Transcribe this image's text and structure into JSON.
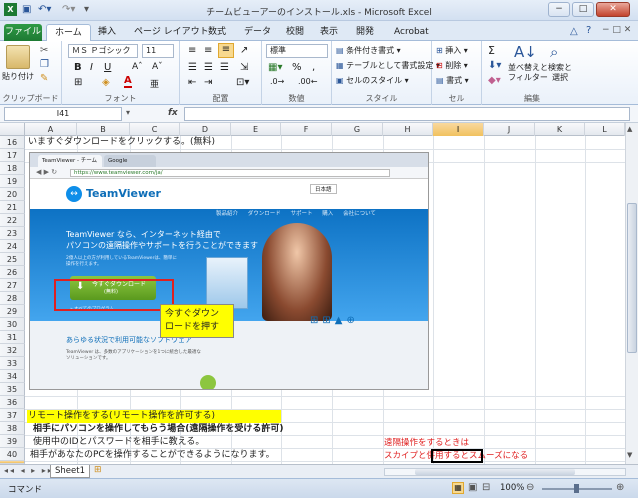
{
  "window": {
    "title": "チームビューアーのインストール.xls - Microsoft Excel",
    "minimize": "−",
    "restore": "□",
    "close": "✕"
  },
  "tabs": [
    {
      "label": "ファイル"
    },
    {
      "label": "ホーム"
    },
    {
      "label": "挿入"
    },
    {
      "label": "ページ レイアウト"
    },
    {
      "label": "数式"
    },
    {
      "label": "データ"
    },
    {
      "label": "校閲"
    },
    {
      "label": "表示"
    },
    {
      "label": "開発"
    },
    {
      "label": "Acrobat"
    }
  ],
  "ribbon": {
    "clipboard": {
      "paste": "貼り付け",
      "label": "クリップボード"
    },
    "font": {
      "name": "ＭＳ Ｐゴシック",
      "size": "11",
      "label": "フォント",
      "bold": "B",
      "italic": "I",
      "underline": "U"
    },
    "alignment": {
      "label": "配置"
    },
    "number": {
      "format": "標準",
      "label": "数値",
      "percent": "%",
      "comma": ","
    },
    "styles": {
      "conditional": "条件付き書式",
      "table": "テーブルとして書式設定",
      "cell": "セルのスタイル",
      "label": "スタイル"
    },
    "cells": {
      "insert": "挿入",
      "delete": "削除",
      "format": "書式",
      "label": "セル"
    },
    "editing": {
      "sum": "Σ",
      "sort": "並べ替えと\nフィルター",
      "find": "検索と\n選択",
      "label": "編集"
    }
  },
  "formula_bar": {
    "name_box": "I41",
    "fx": "fx",
    "value": ""
  },
  "columns": [
    "A",
    "B",
    "C",
    "D",
    "E",
    "F",
    "G",
    "H",
    "I",
    "J",
    "K",
    "L"
  ],
  "selected_column": "I",
  "rows": [
    "16",
    "17",
    "18",
    "19",
    "20",
    "21",
    "22",
    "23",
    "24",
    "25",
    "26",
    "27",
    "28",
    "29",
    "30",
    "31",
    "32",
    "33",
    "34",
    "35",
    "36",
    "37",
    "38",
    "39",
    "40",
    "41"
  ],
  "selected_row": "41",
  "cells": {
    "r16": "いますぐダウンロードをクリックする。(無料)",
    "r38": "リモート操作をする(リモート操作を許可する)",
    "r39": "相手にパソコンを操作してもらう場合(遠隔操作を受ける許可)",
    "r40": "使用中のIDとパスワードを相手に教える。",
    "r41": "相手があなたのPCを操作することができるようになります。",
    "note1": "遠隔操作をするときは",
    "note2_a": "スカイプと",
    "note2_b": "併用すると",
    "note2_c": "スムーズになる"
  },
  "screenshot": {
    "browser_tab1": "TeamViewer - チーム",
    "browser_tab2": "Google",
    "url": "https://www.teamviewer.com/ja/",
    "logo": "TeamViewer",
    "lang": "日本語",
    "nav": [
      "製品紹介",
      "ダウンロード",
      "サポート",
      "購入",
      "会社について"
    ],
    "headline1": "TeamViewer なら、インターネット経由で",
    "headline2": "パソコンの遠隔操作やサポートを行うことができます",
    "body1": "2億人以上の方が利用しているTeamViewerは、簡単に",
    "body2": "操作を行えます。",
    "download_btn": "今すぐダウンロード",
    "download_sub": "(無料)",
    "small_link": "» すべてのプログラム",
    "bottom_title": "あらゆる状況で利用可能なソフトウェア",
    "bottom_text1": "TeamViewer は、多数のアプリケーションを1つに統合した最適な",
    "bottom_text2": "ソリューションです。"
  },
  "callout": {
    "line1": "今すぐダウン",
    "line2": "ロードを押す"
  },
  "sheet_tab": "Sheet1",
  "status": {
    "mode": "コマンド",
    "zoom": "100%"
  }
}
